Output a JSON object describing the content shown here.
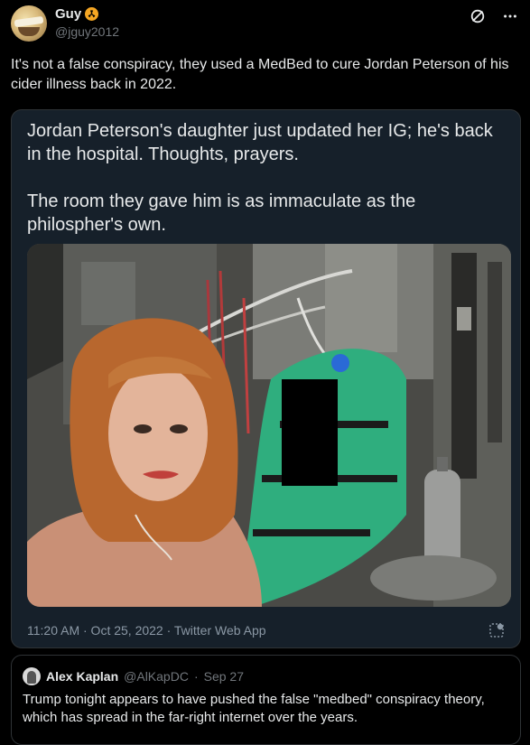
{
  "tweet": {
    "display_name": "Guy",
    "handle": "@jguy2012",
    "text": "It's not a false conspiracy, they used a MedBed to cure Jordan Peterson of his cider illness back in 2022."
  },
  "quoted_post": {
    "paragraph1": "Jordan Peterson's daughter just updated her IG; he's back in the hospital. Thoughts, prayers.",
    "paragraph2": "The room they gave him is as immaculate as the philospher's own.",
    "meta": "11:20 AM · Oct 25, 2022 · Twitter Web App"
  },
  "bottom_quote": {
    "name": "Alex Kaplan",
    "handle": "@AlKapDC",
    "separator": "·",
    "date": "Sep 27",
    "text": "Trump tonight appears to have pushed the false \"medbed\" conspiracy theory, which has spread in the far-right internet over the years."
  },
  "icons": {
    "verified_badge": "radioactive-icon",
    "grok": "slash-circle-icon",
    "more": "more-icon",
    "alt": "alt-text-icon"
  },
  "colors": {
    "background": "#000000",
    "card": "#16202a",
    "muted": "#71767b",
    "badge": "#f5a623",
    "green_sheet": "#2fae7e"
  }
}
